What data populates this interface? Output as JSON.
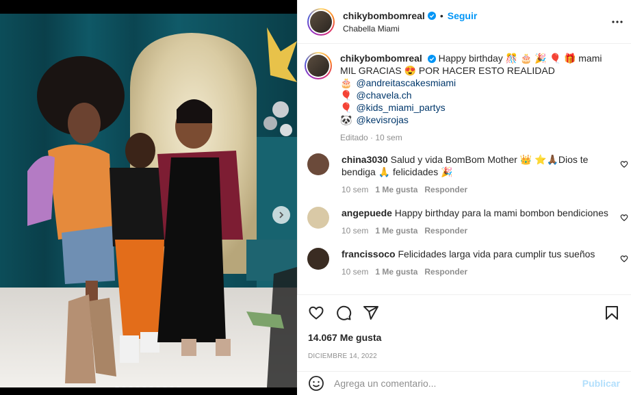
{
  "post": {
    "username": "chikybombomreal",
    "follow_label": "Seguir",
    "location": "Chabella Miami",
    "separator": "•"
  },
  "caption": {
    "username": "chikybombomreal",
    "text_line1": "Happy birthday 🎊 🎂 🎉 🎈 🎁  mami",
    "text_line2": "MIL GRACIAS 😍  POR HACER ESTO REALIDAD",
    "credits": [
      {
        "emoji": "🎂",
        "mention": "@andreitascakesmiami"
      },
      {
        "emoji": "🎈",
        "mention": "@chavela.ch"
      },
      {
        "emoji": "🎈",
        "mention": "@kids_miami_partys"
      },
      {
        "emoji": "🐼",
        "mention": "@kevisrojas"
      }
    ],
    "edited": "Editado · 10 sem"
  },
  "comments": [
    {
      "username": "china3030",
      "text": "Salud y vida BomBom Mother 👑 ⭐️🙏🏾Dios te bendiga 🙏 felicidades 🎉",
      "time": "10 sem",
      "likes": "1 Me gusta",
      "reply": "Responder",
      "avatar_color": "#6b4a3a"
    },
    {
      "username": "angepuede",
      "text": "Happy birthday para la mami bombon bendiciones",
      "time": "10 sem",
      "likes": "1 Me gusta",
      "reply": "Responder",
      "avatar_color": "#d9c9a6"
    },
    {
      "username": "francissoco",
      "text": "Felicidades larga vida para cumplir tus sueños",
      "time": "10 sem",
      "likes": "1 Me gusta",
      "reply": "Responder",
      "avatar_color": "#3a2c22"
    }
  ],
  "actions": {
    "likes_count": "14.067 Me gusta",
    "date": "DICIEMBRE 14, 2022"
  },
  "composer": {
    "placeholder": "Agrega un comentario...",
    "post_label": "Publicar"
  },
  "carousel": {
    "total": 10,
    "active": 0
  },
  "icons": [
    "heart-icon",
    "comment-icon",
    "share-icon",
    "bookmark-icon",
    "emoji-icon",
    "more-icon",
    "verified-icon",
    "chevron-right-icon"
  ],
  "colors": {
    "accent": "#0095f6",
    "verified": "#0095f6",
    "muted": "#8e8e8e",
    "mention": "#00376b"
  }
}
